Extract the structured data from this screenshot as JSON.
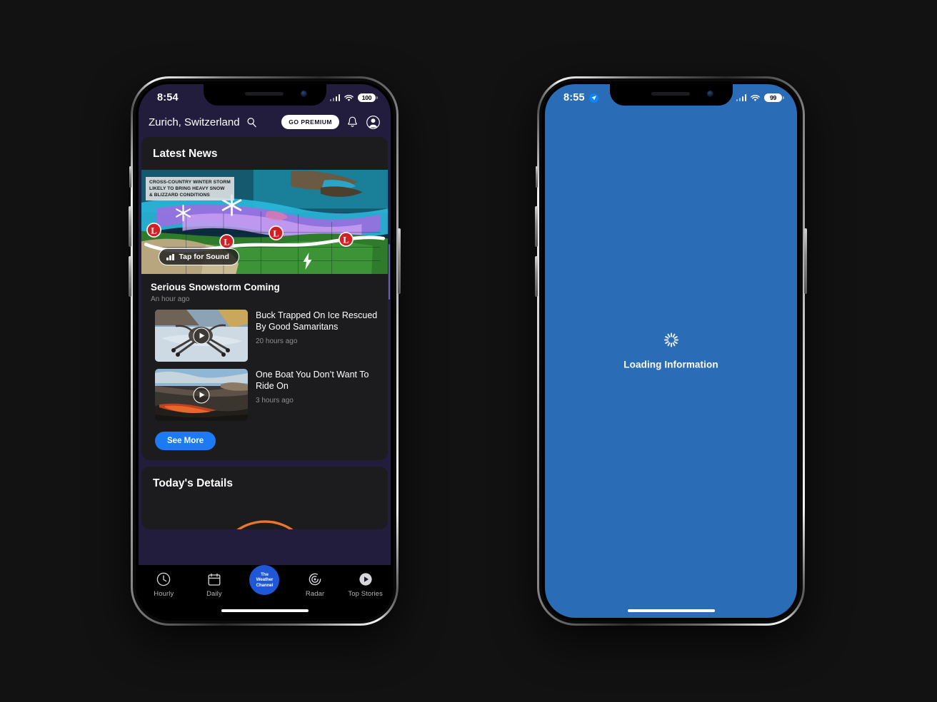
{
  "background_color": "#121212",
  "phones": {
    "left": {
      "status_bar": {
        "time": "8:54",
        "battery": "100",
        "wifi_icon": "wifi-icon",
        "signal_icon": "cellular-signal-icon"
      },
      "header": {
        "location": "Zurich, Switzerland",
        "search_icon": "search-icon",
        "premium_label": "GO PREMIUM",
        "bell_icon": "bell-icon",
        "profile_icon": "profile-avatar-icon"
      },
      "news_card": {
        "title": "Latest News",
        "hero": {
          "caption_line1": "CROSS-COUNTRY WINTER STORM",
          "caption_line2": "LIKELY TO BRING HEAVY SNOW",
          "caption_line3": "& BLIZZARD CONDITIONS",
          "sound_label": "Tap for Sound",
          "sound_icon": "audio-bars-icon",
          "lightning_icon": "lightning-bolt-icon"
        },
        "featured": {
          "title": "Serious Snowstorm Coming",
          "time": "An hour ago"
        },
        "items": [
          {
            "title": "Buck Trapped On Ice Rescued By Good Samaritans",
            "time": "20 hours ago",
            "thumb": "deer-on-ice-thumbnail",
            "play_icon": "play-icon"
          },
          {
            "title": "One Boat You Don’t Want To Ride On",
            "time": "3 hours ago",
            "thumb": "lava-field-thumbnail",
            "play_icon": "play-icon"
          }
        ],
        "see_more_label": "See More"
      },
      "details_card": {
        "title": "Today's Details"
      },
      "tabbar": [
        {
          "label": "Hourly",
          "icon": "clock-icon"
        },
        {
          "label": "Daily",
          "icon": "calendar-icon"
        },
        {
          "label": "The Weather Channel",
          "icon": "weather-channel-logo",
          "logo_line1": "The",
          "logo_line2": "Weather",
          "logo_line3": "Channel"
        },
        {
          "label": "Radar",
          "icon": "radar-icon"
        },
        {
          "label": "Top Stories",
          "icon": "play-circle-icon"
        }
      ]
    },
    "right": {
      "status_bar": {
        "time": "8:55",
        "battery": "99",
        "location_icon": "location-arrow-icon",
        "wifi_icon": "wifi-icon",
        "signal_icon": "cellular-signal-icon"
      },
      "loading": {
        "text": "Loading Information",
        "spinner_icon": "spinner-icon"
      },
      "screen_color": "#2a6cb5"
    }
  },
  "colors": {
    "accent_blue": "#1c7bf4",
    "twc_blue": "#1f57d6",
    "app_bg": "#231d3d",
    "card_bg": "#1c1c1e",
    "loading_blue": "#2a6cb5",
    "arc_orange": "#e8762c"
  }
}
